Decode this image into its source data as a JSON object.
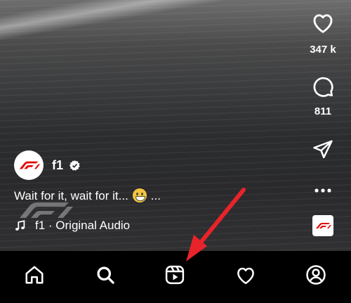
{
  "reel": {
    "like_count": "347 k",
    "comment_count": "811",
    "account": {
      "username": "f1"
    },
    "caption": {
      "text_before": "Wait for it, wait for it...",
      "text_after": "..."
    },
    "audio": {
      "label": "f1 · Original Audio"
    }
  },
  "nav": {
    "items": [
      {
        "icon": "home-icon"
      },
      {
        "icon": "search-icon"
      },
      {
        "icon": "reels-icon"
      },
      {
        "icon": "heart-icon"
      },
      {
        "icon": "profile-icon"
      }
    ]
  },
  "colors": {
    "brand": "#e10600",
    "annotation_arrow": "#e8232a",
    "nav_background": "#000000"
  }
}
